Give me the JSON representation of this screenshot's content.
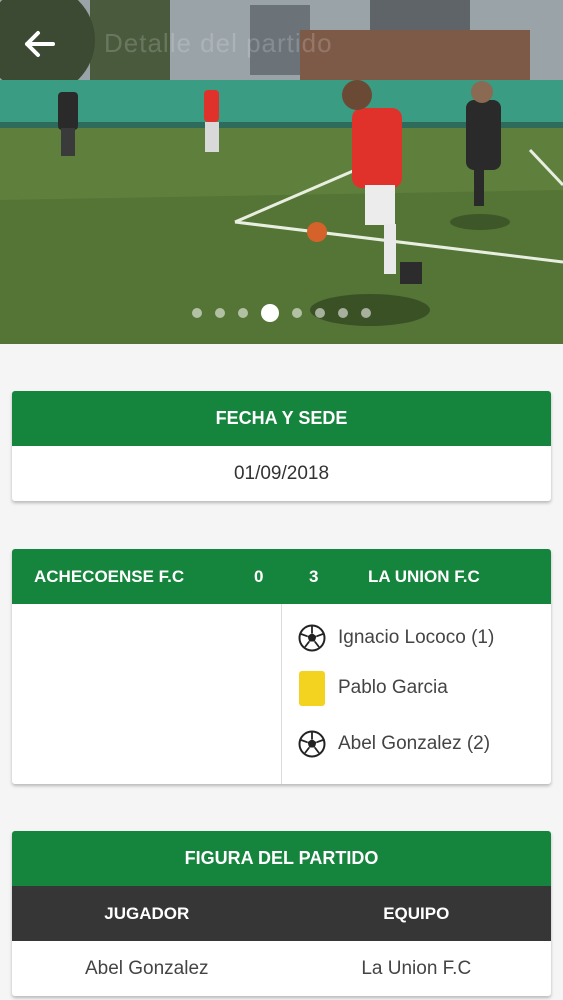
{
  "header": {
    "title": "Detalle del partido",
    "back_icon": "arrow-left-icon"
  },
  "carousel": {
    "slide_count": 8,
    "active_index": 3
  },
  "fecha_sede": {
    "title": "FECHA Y SEDE",
    "date": "01/09/2018"
  },
  "match": {
    "home_team": "ACHECOENSE F.C",
    "home_score": "0",
    "away_score": "3",
    "away_team": "LA UNION F.C",
    "home_events": [],
    "away_events": [
      {
        "icon": "soccer-ball-icon",
        "text": "Ignacio Lococo (1)"
      },
      {
        "icon": "yellow-card-icon",
        "text": "Pablo Garcia"
      },
      {
        "icon": "soccer-ball-icon",
        "text": "Abel Gonzalez (2)"
      }
    ]
  },
  "figura": {
    "title": "FIGURA DEL PARTIDO",
    "col_player": "JUGADOR",
    "col_team": "EQUIPO",
    "player": "Abel Gonzalez",
    "team": "La Union F.C"
  },
  "colors": {
    "brand_green": "#15843d",
    "table_header_dark": "#363636",
    "yellow_card": "#f4d320"
  }
}
